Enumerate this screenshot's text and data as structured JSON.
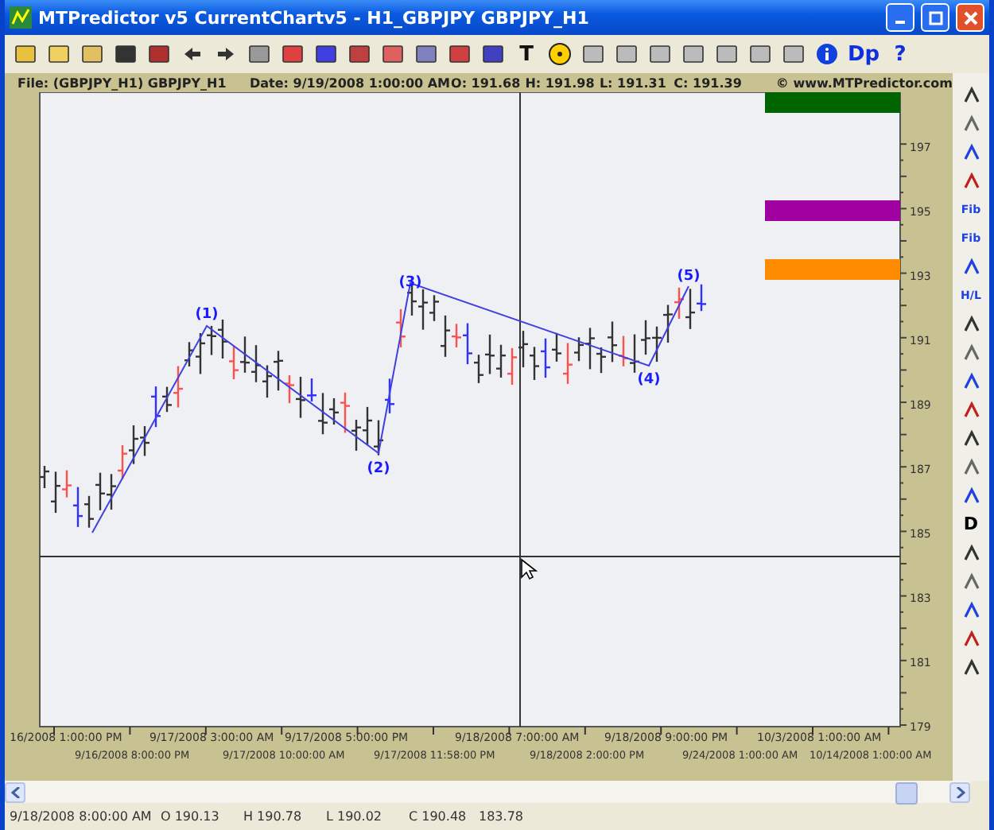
{
  "window": {
    "title": "MTPredictor v5 CurrentChartv5 - H1_GBPJPY GBPJPY_H1"
  },
  "toolbar_text_buttons": [
    "T",
    "Dp",
    "?"
  ],
  "chart_header": {
    "file": "File: (GBPJPY_H1) GBPJPY_H1",
    "date": "Date: 9/19/2008 1:00:00 AM",
    "open": "O:  191.68",
    "high": "H:  191.98",
    "low": "L:  191.31",
    "close": "C:  191.39",
    "copyright": "© www.MTPredictor.com"
  },
  "price_axis": [
    "197",
    "195",
    "193",
    "191",
    "189",
    "187",
    "185",
    "183",
    "181",
    "179"
  ],
  "time_axis_upper": [
    "16/2008 1:00:00 PM",
    "9/17/2008 3:00:00 AM",
    "9/17/2008 5:00:00 PM",
    "9/18/2008 7:00:00 AM",
    "9/18/2008 9:00:00 PM",
    "10/3/2008 1:00:00 AM"
  ],
  "time_axis_lower": [
    "9/16/2008 8:00:00 PM",
    "9/17/2008 10:00:00 AM",
    "9/17/2008 11:58:00 PM",
    "9/18/2008 2:00:00 PM",
    "9/24/2008 1:00:00 AM",
    "10/14/2008 1:00:00 AM"
  ],
  "wave_labels": [
    "(1)",
    "(2)",
    "(3)",
    "(4)",
    "(5)"
  ],
  "target_zones": [
    {
      "color": "#006400"
    },
    {
      "color": "#a000a0"
    },
    {
      "color": "#ff8c00"
    }
  ],
  "right_toolbar_texts": [
    "Fib",
    "Fib",
    "H/L",
    "D"
  ],
  "status_bar": [
    "9/18/2008 8:00:00 AM",
    "O 190.13",
    "H 190.78",
    "L 190.02",
    "C 190.48",
    "183.78"
  ]
}
